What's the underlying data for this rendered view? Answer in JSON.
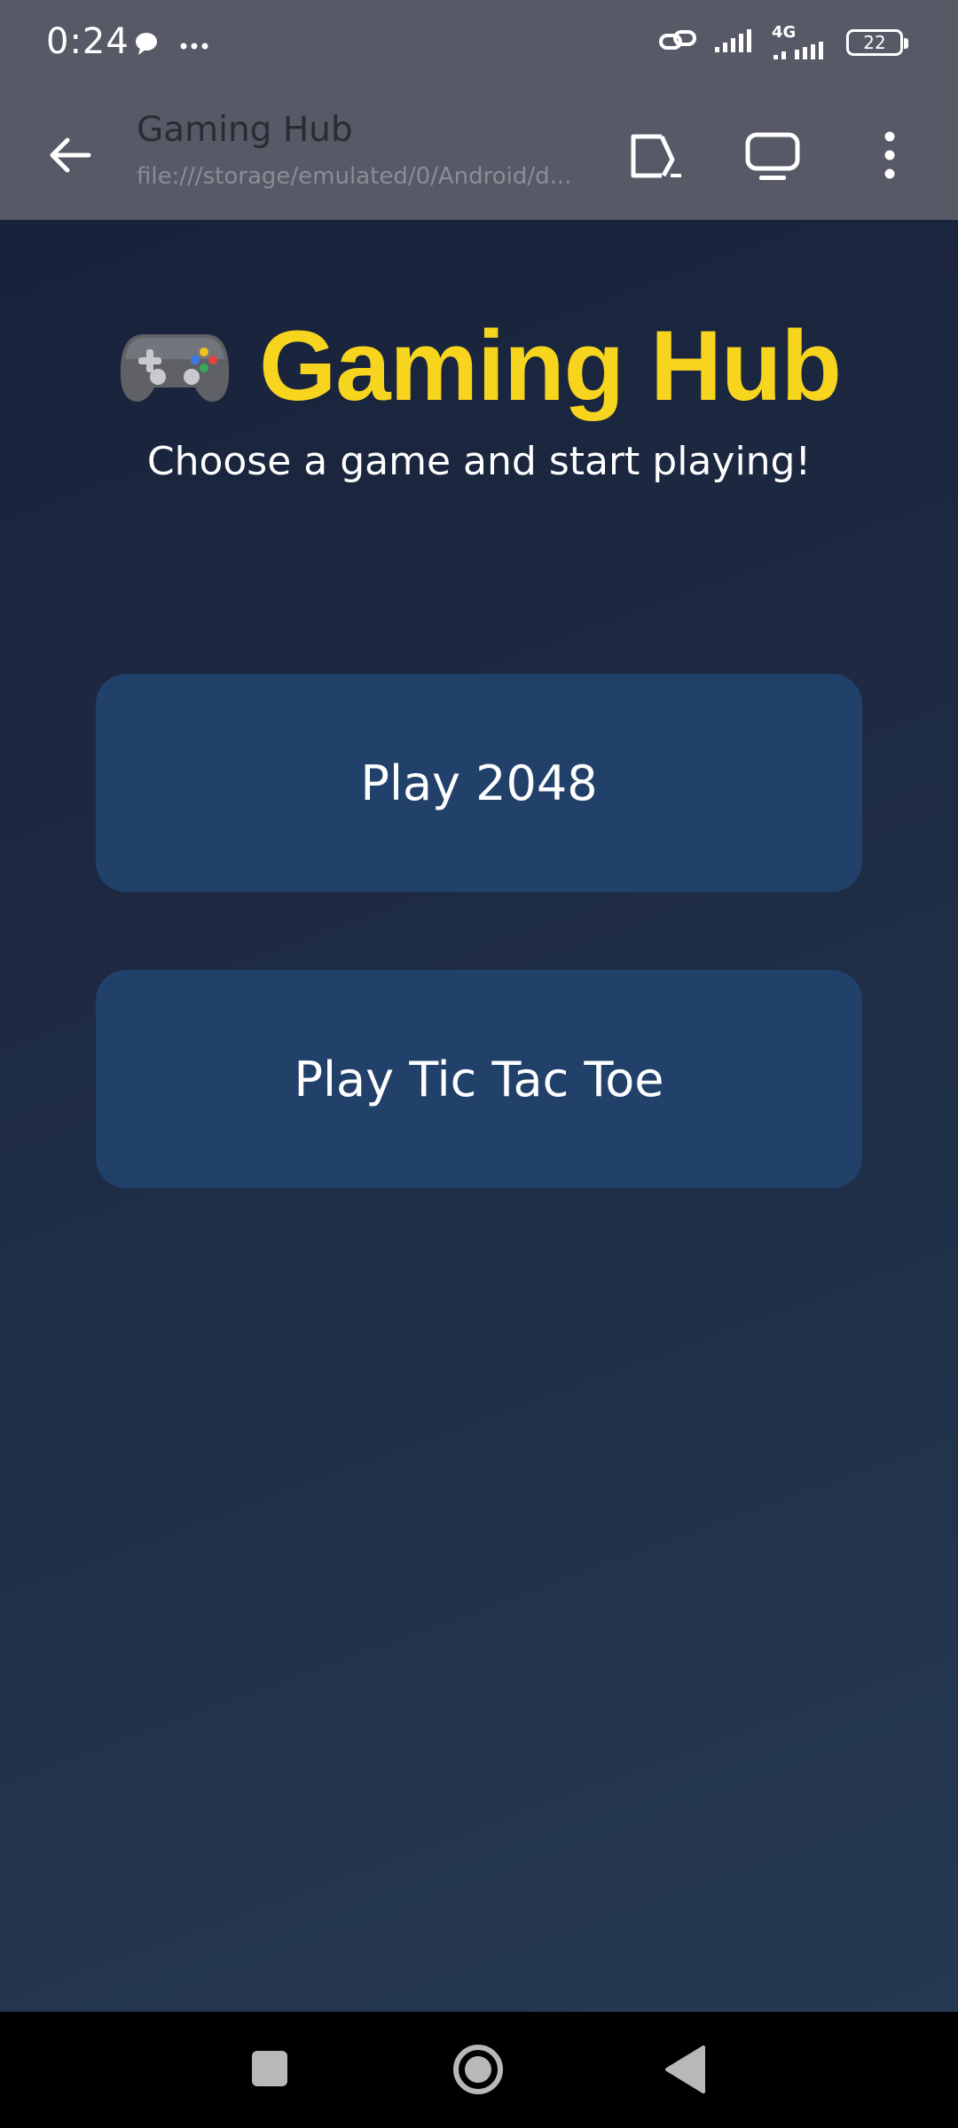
{
  "status_bar": {
    "time": "0:24",
    "network_label": "4G",
    "battery_level": "22",
    "icons": [
      "chat-bubble-icon",
      "more-dots-icon",
      "link-icon",
      "signal-icon",
      "signal-4g-icon",
      "battery-icon"
    ]
  },
  "toolbar": {
    "title": "Gaming Hub",
    "url": "file:///storage/emulated/0/Android/d...",
    "icons": [
      "back-arrow-icon",
      "open-external-icon",
      "desktop-mode-icon",
      "overflow-menu-icon"
    ]
  },
  "hero": {
    "emoji": "🎮",
    "title": "Gaming Hub",
    "subtitle": "Choose a game and start playing!"
  },
  "games": [
    {
      "label": "Play 2048"
    },
    {
      "label": "Play Tic Tac Toe"
    }
  ],
  "colors": {
    "title": "#f7d51e",
    "button": "#21416b",
    "background_top": "#18223a",
    "background_bottom": "#253953",
    "chrome": "#575a66"
  },
  "nav_bar": {
    "icons": [
      "recent-apps-icon",
      "home-icon",
      "back-icon"
    ]
  }
}
